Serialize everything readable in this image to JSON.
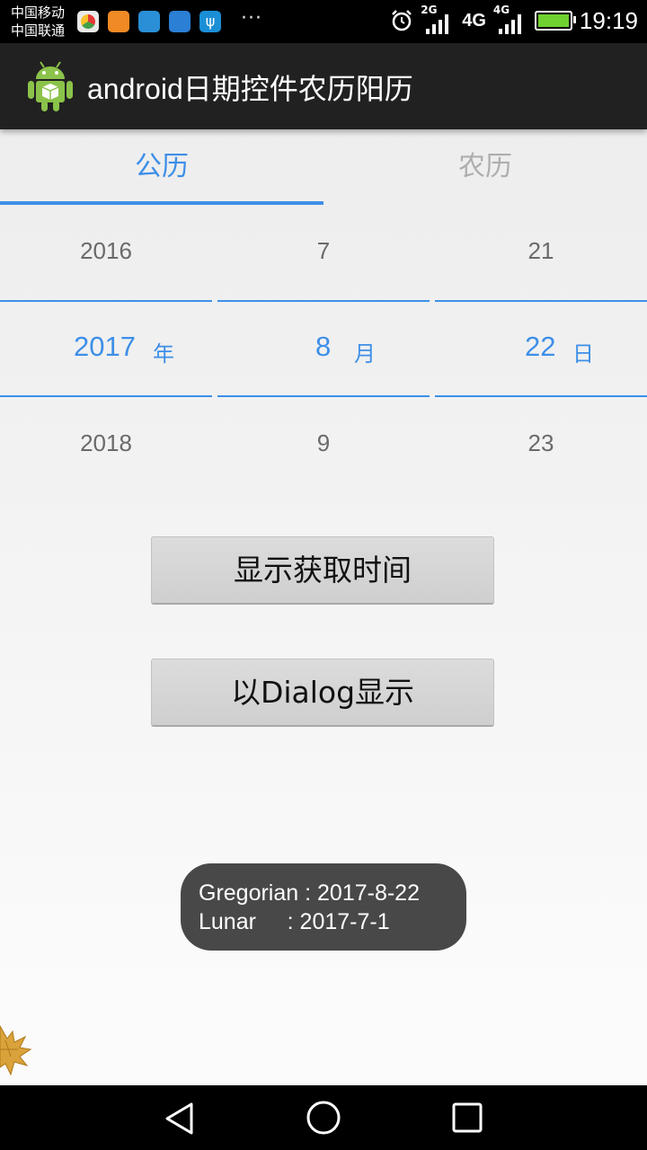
{
  "status_bar": {
    "carrier_1": "中国移动",
    "carrier_2": "中国联通",
    "overflow": "···",
    "network_1_small": "2G",
    "network_2": "4G",
    "network_2_small": "4G",
    "time": "19:19",
    "colors": {
      "background": "#000000",
      "battery": "#6fd12f"
    }
  },
  "action_bar": {
    "title": "android日期控件农历阳历",
    "icon": "android-robot-icon"
  },
  "tabs": [
    {
      "label": "公历",
      "selected": true
    },
    {
      "label": "农历",
      "selected": false
    }
  ],
  "picker": {
    "year": {
      "prev": "2016",
      "value": "2017",
      "next": "2018",
      "unit": "年"
    },
    "month": {
      "prev": "7",
      "value": "8",
      "next": "9",
      "unit": "月"
    },
    "day": {
      "prev": "21",
      "value": "22",
      "next": "23",
      "unit": "日"
    },
    "accent_color": "#3d8fe8"
  },
  "buttons": {
    "show_time": "显示获取时间",
    "show_dialog": "以Dialog显示"
  },
  "toast": {
    "line1": "Gregorian : 2017-8-22",
    "line2": "Lunar     : 2017-7-1"
  },
  "nav_bar": {
    "back": "back-triangle-icon",
    "home": "home-circle-icon",
    "recents": "recents-square-icon"
  }
}
